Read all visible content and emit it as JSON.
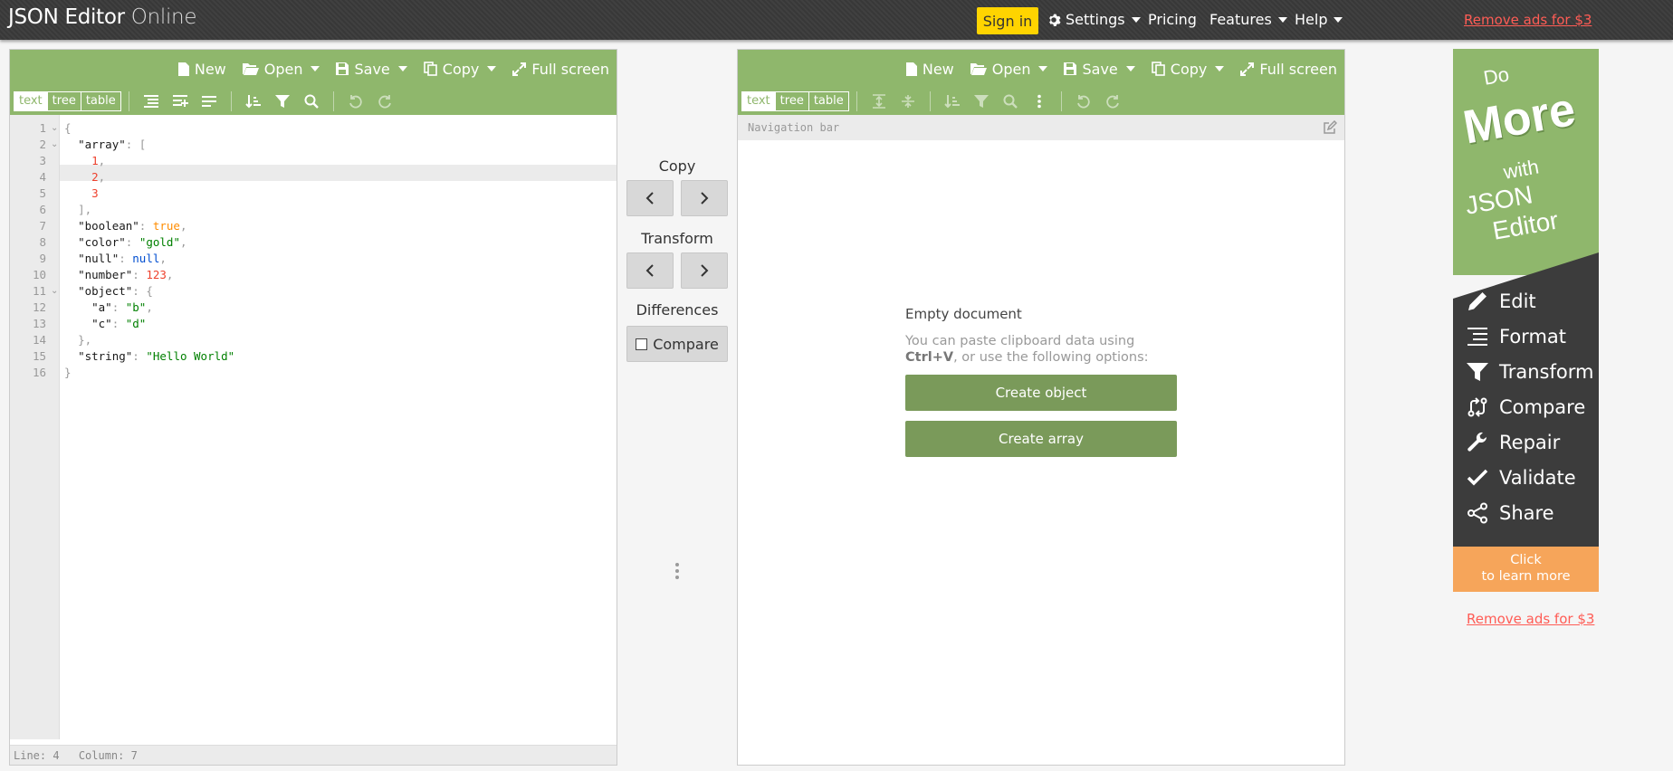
{
  "header": {
    "title_main": "JSON Editor",
    "title_sub": "Online",
    "sign_in": "Sign in",
    "settings": "Settings",
    "pricing": "Pricing",
    "features": "Features",
    "help": "Help",
    "remove_ads": "Remove ads for $3"
  },
  "left_panel": {
    "menu": {
      "new": "New",
      "open": "Open",
      "save": "Save",
      "copy": "Copy",
      "fullscreen": "Full screen"
    },
    "modes": [
      "text",
      "tree",
      "table"
    ],
    "active_mode": "text",
    "line_numbers": [
      "1",
      "2",
      "3",
      "4",
      "5",
      "6",
      "7",
      "8",
      "9",
      "10",
      "11",
      "12",
      "13",
      "14",
      "15",
      "16"
    ],
    "status": {
      "line": "Line: 4",
      "column": "Column: 7"
    }
  },
  "middle": {
    "copy_label": "Copy",
    "transform_label": "Transform",
    "differences_label": "Differences",
    "compare_label": "Compare"
  },
  "right_panel": {
    "menu": {
      "new": "New",
      "open": "Open",
      "save": "Save",
      "copy": "Copy",
      "fullscreen": "Full screen"
    },
    "modes": [
      "text",
      "tree",
      "table"
    ],
    "active_mode": "tree",
    "navigation_bar": "Navigation bar",
    "empty_title": "Empty document",
    "empty_info_1": "You can paste clipboard data using",
    "empty_info_key": "Ctrl+V",
    "empty_info_2": ", or use the following options:",
    "create_object": "Create object",
    "create_array": "Create array"
  },
  "ad": {
    "do": "Do",
    "more": "More",
    "with": "with",
    "json": "JSON",
    "editor": "Editor",
    "features": [
      "Edit",
      "Format",
      "Transform",
      "Compare",
      "Repair",
      "Validate",
      "Share"
    ],
    "cta_1": "Click",
    "cta_2": "to learn more",
    "remove_ads": "Remove ads for $3"
  },
  "colors": {
    "menubar_green": "#8fb76c",
    "sign_in_yellow": "#ffd400",
    "remove_ads_red": "#ff5c55",
    "create_button": "#7a9a5a",
    "ad_orange": "#f6a55a"
  }
}
